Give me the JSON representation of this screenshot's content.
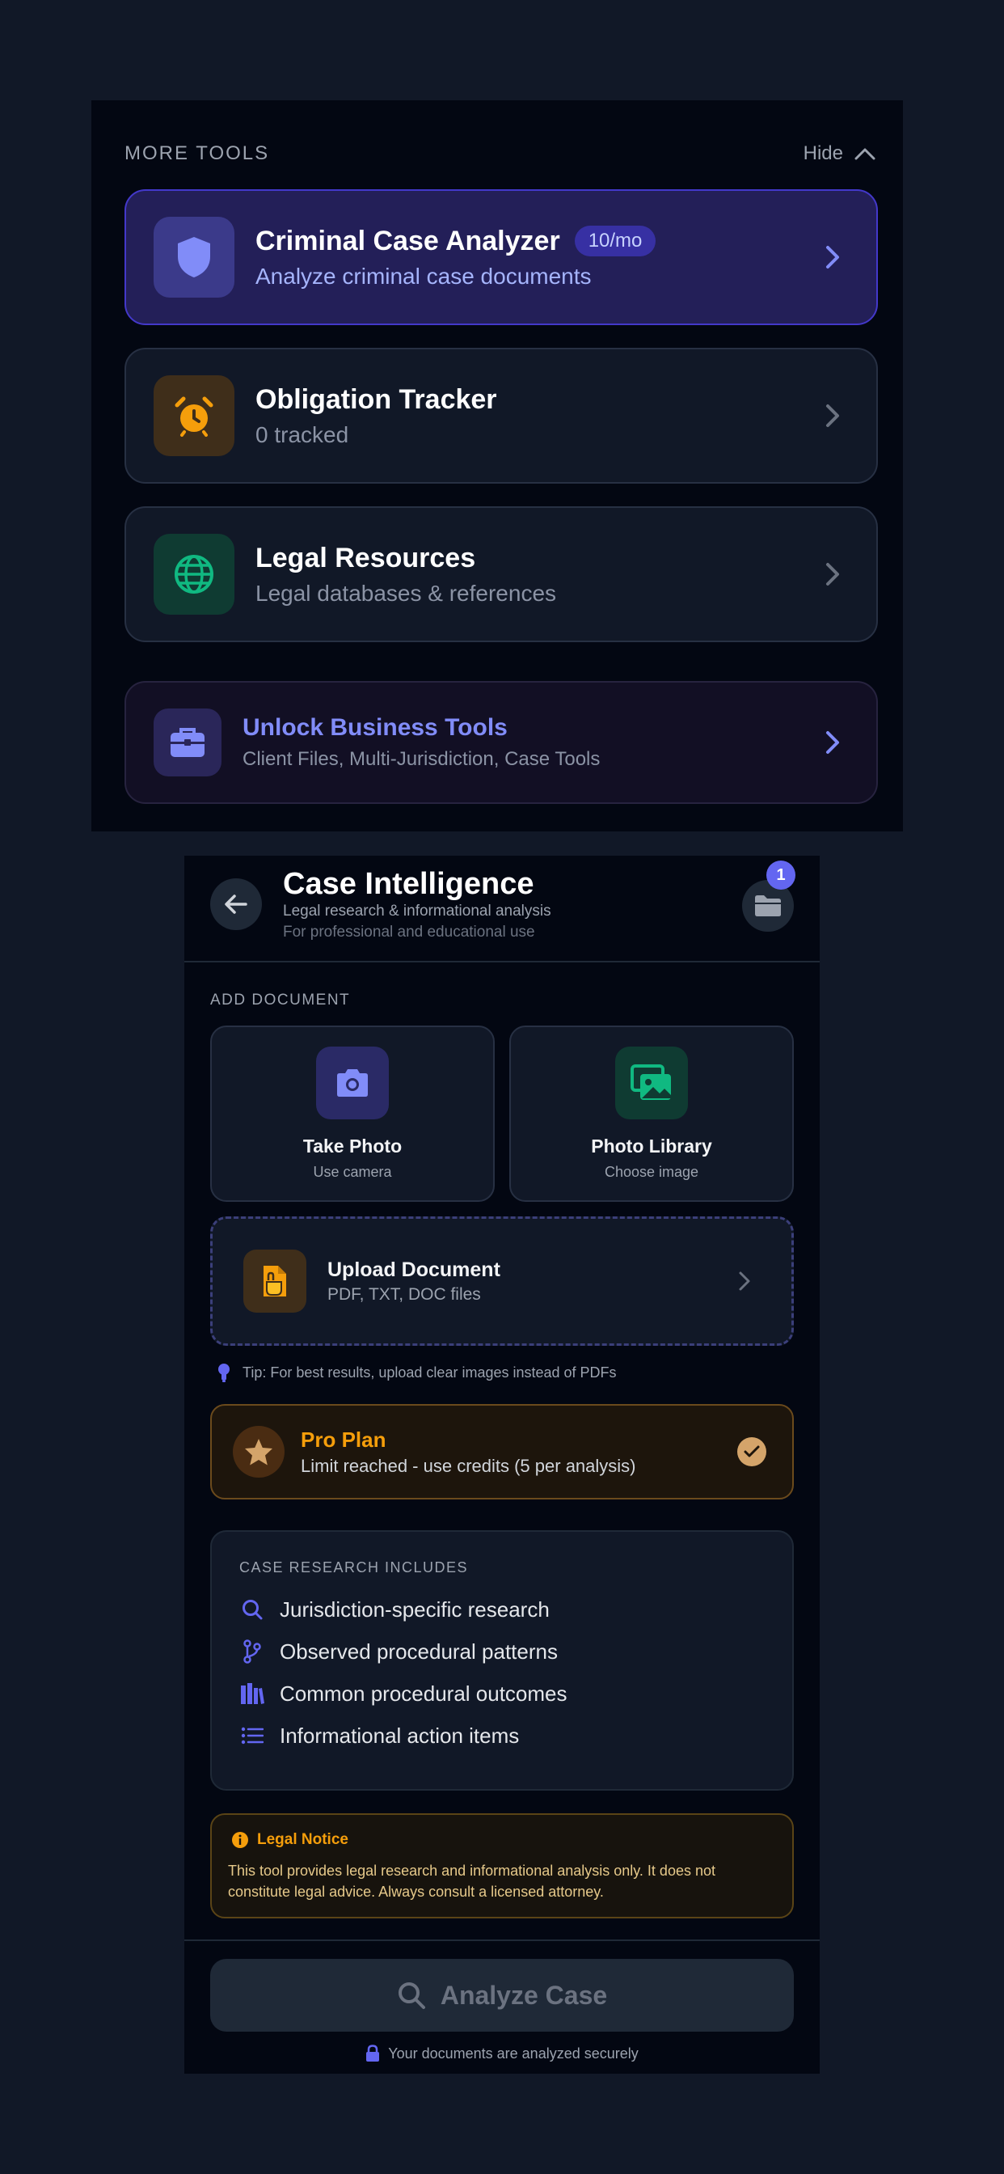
{
  "more_tools": {
    "section_label": "MORE TOOLS",
    "hide_label": "Hide",
    "tools": [
      {
        "title": "Criminal Case Analyzer",
        "badge": "10/mo",
        "subtitle": "Analyze criminal case documents",
        "icon": "shield-icon"
      },
      {
        "title": "Obligation Tracker",
        "subtitle": "0 tracked",
        "icon": "alarm-clock-icon"
      },
      {
        "title": "Legal Resources",
        "subtitle": "Legal databases & references",
        "icon": "globe-icon"
      }
    ],
    "business": {
      "title": "Unlock Business Tools",
      "subtitle": "Client Files, Multi-Jurisdiction, Case Tools",
      "icon": "briefcase-icon"
    },
    "colors": {
      "accent": "#6366f1",
      "active_card": "#231f58",
      "amber": "#f59e0b",
      "green": "#10b981"
    }
  },
  "case_intel": {
    "title": "Case Intelligence",
    "subtitle1": "Legal research & informational analysis",
    "subtitle2": "For professional and educational use",
    "folder_badge": "1",
    "add_document_label": "ADD DOCUMENT",
    "take_photo": {
      "title": "Take Photo",
      "subtitle": "Use camera"
    },
    "photo_library": {
      "title": "Photo Library",
      "subtitle": "Choose image"
    },
    "upload": {
      "title": "Upload Document",
      "subtitle": "PDF, TXT, DOC files"
    },
    "tip": "Tip: For best results, upload clear images instead of PDFs",
    "pro_plan": {
      "title": "Pro Plan",
      "subtitle": "Limit reached - use credits (5 per analysis)"
    },
    "research": {
      "header": "CASE RESEARCH INCLUDES",
      "items": [
        "Jurisdiction-specific research",
        "Observed procedural patterns",
        "Common procedural outcomes",
        "Informational action items"
      ]
    },
    "notice": {
      "title": "Legal Notice",
      "body": "This tool provides legal research and informational analysis only. It does not constitute legal advice. Always consult a licensed attorney."
    },
    "analyze_button": "Analyze Case",
    "secure_note": "Your documents are analyzed securely"
  }
}
